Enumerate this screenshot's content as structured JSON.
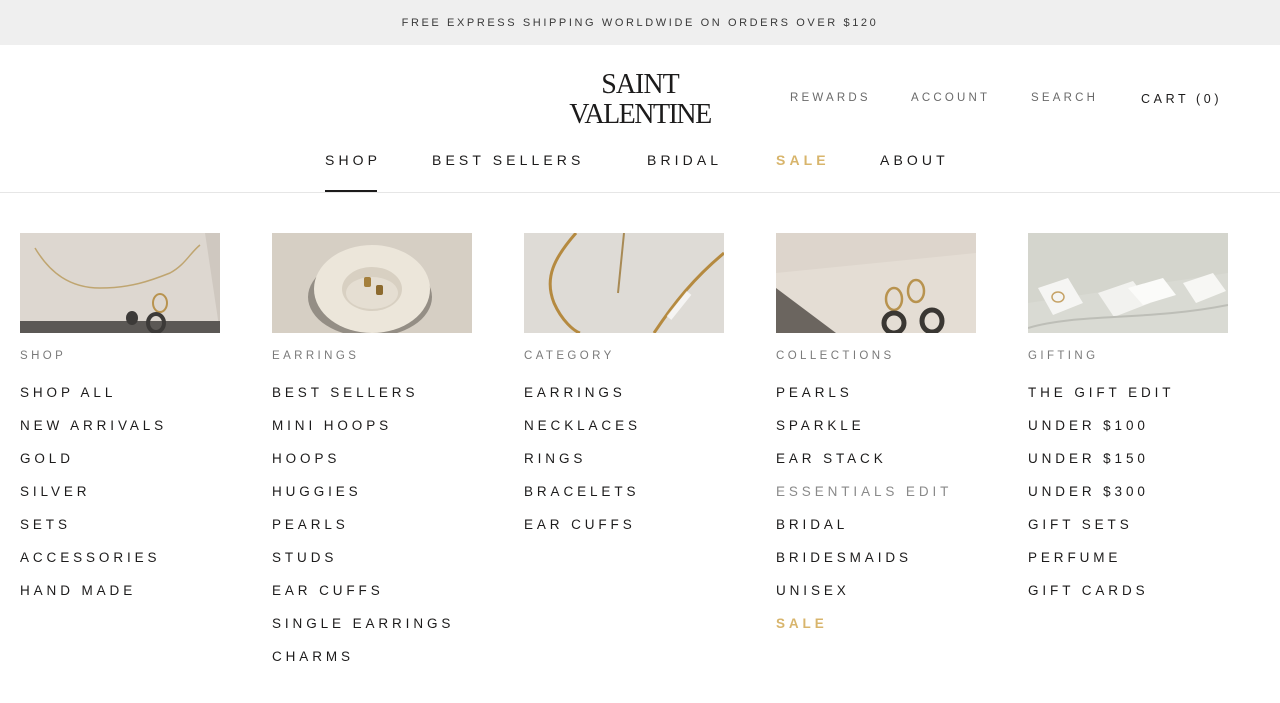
{
  "announcement": {
    "text": "FREE EXPRESS SHIPPING WORLDWIDE ON ORDERS OVER $120"
  },
  "logo": {
    "line1": "SAINT",
    "line2": "VALENTINE"
  },
  "utility_nav": {
    "rewards": "REWARDS",
    "account": "ACCOUNT",
    "search": "SEARCH",
    "cart": "CART (0)"
  },
  "main_nav": [
    {
      "label": "SHOP",
      "active": true
    },
    {
      "label": "BEST SELLERS"
    },
    {
      "label": "BRIDAL"
    },
    {
      "label": "SALE",
      "highlight": true
    },
    {
      "label": "ABOUT"
    }
  ],
  "colors": {
    "accent_sale": "#d8b56c",
    "text": "#1c1b1b",
    "muted": "#7a7a7a",
    "banner_bg": "#efefef"
  },
  "mega_menu": {
    "columns": [
      {
        "heading": "SHOP",
        "image": "necklace-and-hoops-photo",
        "items": [
          "SHOP ALL",
          "NEW ARRIVALS",
          "GOLD",
          "SILVER",
          "SETS",
          "ACCESSORIES",
          "HAND MADE"
        ]
      },
      {
        "heading": "EARRINGS",
        "image": "earrings-in-dish-photo",
        "items": [
          "BEST SELLERS",
          "MINI HOOPS",
          "HOOPS",
          "HUGGIES",
          "PEARLS",
          "STUDS",
          "EAR CUFFS",
          "SINGLE EARRINGS",
          "CHARMS"
        ]
      },
      {
        "heading": "CATEGORY",
        "image": "snake-chain-photo",
        "items": [
          "EARRINGS",
          "NECKLACES",
          "RINGS",
          "BRACELETS",
          "EAR CUFFS"
        ]
      },
      {
        "heading": "COLLECTIONS",
        "image": "hoop-earrings-photo",
        "items": [
          "PEARLS",
          "SPARKLE",
          "EAR STACK",
          "ESSENTIALS EDIT",
          "BRIDAL",
          "BRIDESMAIDS",
          "UNISEX",
          "SALE"
        ],
        "muted_item": "ESSENTIALS EDIT",
        "sale_item": "SALE"
      },
      {
        "heading": "GIFTING",
        "image": "gift-boxes-photo",
        "items": [
          "THE GIFT EDIT",
          "UNDER $100",
          "UNDER $150",
          "UNDER $300",
          "GIFT SETS",
          "PERFUME",
          "GIFT CARDS"
        ]
      }
    ]
  }
}
